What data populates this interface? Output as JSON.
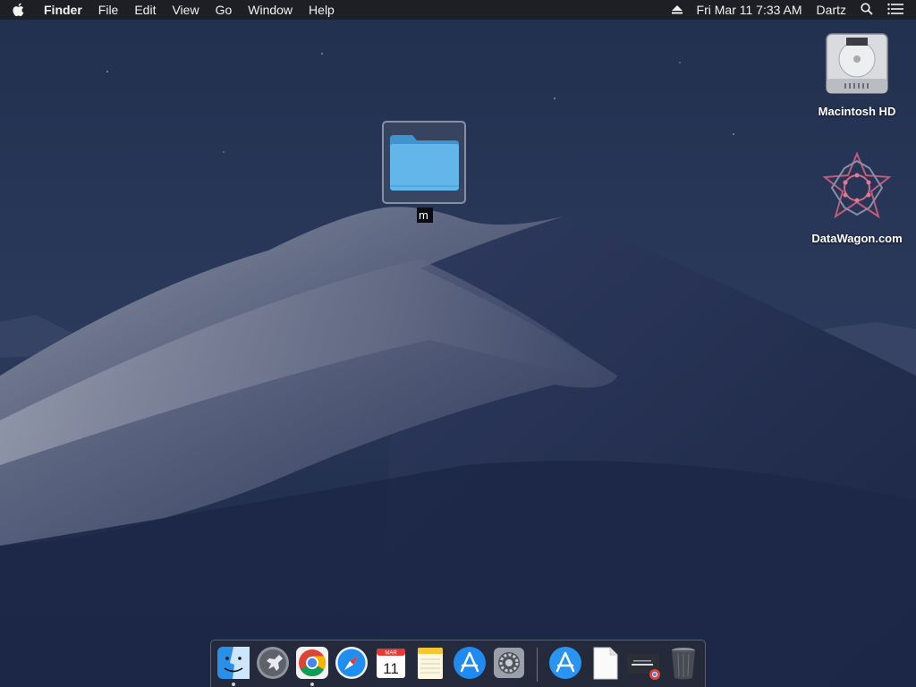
{
  "menubar": {
    "app_name": "Finder",
    "menus": [
      "File",
      "Edit",
      "View",
      "Go",
      "Window",
      "Help"
    ],
    "clock": "Fri Mar 11  7:33 AM",
    "user": "Dartz",
    "icons": [
      "apple-icon",
      "eject-icon",
      "spotlight-search-icon",
      "notification-center-icon"
    ]
  },
  "desktop": {
    "icons": [
      {
        "label": "Macintosh HD",
        "icon": "hard-drive-icon"
      },
      {
        "label": "DataWagon.com",
        "icon": "datawagon-logo-icon"
      }
    ],
    "folder": {
      "icon": "folder-icon",
      "rename_value": "m"
    }
  },
  "dock": {
    "items": [
      {
        "name": "finder",
        "running": true
      },
      {
        "name": "launchpad",
        "running": false
      },
      {
        "name": "chrome",
        "running": true
      },
      {
        "name": "safari",
        "running": false
      },
      {
        "name": "calendar",
        "running": false,
        "month": "MAR",
        "day": "11"
      },
      {
        "name": "notes",
        "running": false
      },
      {
        "name": "app-store",
        "running": false
      },
      {
        "name": "system-preferences",
        "running": false
      },
      {
        "name": "app-store-download",
        "running": false
      },
      {
        "name": "document",
        "running": false
      },
      {
        "name": "chrome-window",
        "running": false
      },
      {
        "name": "trash",
        "running": false
      }
    ]
  },
  "colors": {
    "folder_blue": "#5ab0e8",
    "menubar_bg": "#1e1e22",
    "sky": "#1e2c4b"
  }
}
